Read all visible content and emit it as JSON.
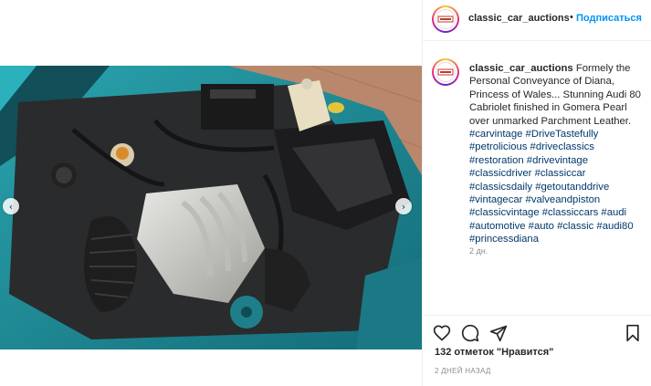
{
  "header": {
    "username": "classic_car_auctions",
    "separator": "•",
    "follow_label": "Подписаться",
    "avatar_icon": "classic-car-auctions-logo"
  },
  "caption": {
    "username": "classic_car_auctions",
    "text": "Formely the Personal Conveyance of Diana, Princess of Wales... Stunning Audi 80 Cabriolet finished in Gomera Pearl over unmarked Parchment Leather.",
    "hashtags": "#carvintage #DriveTastefully #petrolicious #driveclassics #restoration #drivevintage #classicdriver #classiccar #classicsdaily #getoutanddrive #vintagecar #valveandpiston #classicvintage #classiccars #audi #automotive #auto #classic #audi80 #princessdiana",
    "time": "2 дн."
  },
  "actions": {
    "like_icon": "heart-icon",
    "comment_icon": "comment-icon",
    "share_icon": "paper-plane-icon",
    "save_icon": "bookmark-icon",
    "likes_text": "132 отметок \"Нравится\"",
    "date_text": "2 ДНЕЙ НАЗАД"
  },
  "media": {
    "prev_icon": "chevron-left-icon",
    "next_icon": "chevron-right-icon",
    "prev_glyph": "‹",
    "next_glyph": "›"
  },
  "colors": {
    "link": "#0095f6",
    "hashtag": "#00376b",
    "car_paint": "#1f8a96"
  }
}
